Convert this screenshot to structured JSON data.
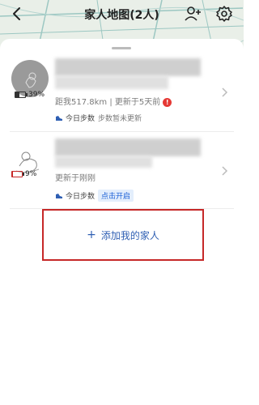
{
  "header": {
    "title": "家人地图(2人)",
    "back_icon": "chevron-left-icon",
    "add_icon": "add-person-icon",
    "settings_icon": "gear-icon"
  },
  "members": [
    {
      "battery": "39%",
      "battery_level": 0.39,
      "location": "距我517.8km | 更新于5天前",
      "warning": "!",
      "steps_label": "今日步数",
      "steps_status": "步数暂未更新"
    },
    {
      "battery": "9%",
      "battery_level": 0.09,
      "location": "更新于刚刚",
      "steps_label": "今日步数",
      "steps_action": "点击开启"
    }
  ],
  "add_family": {
    "plus": "+",
    "label": "添加我的家人"
  },
  "colors": {
    "accent_blue": "#2f5fb3",
    "warning_red": "#e53935",
    "highlight_border": "#c62828"
  }
}
